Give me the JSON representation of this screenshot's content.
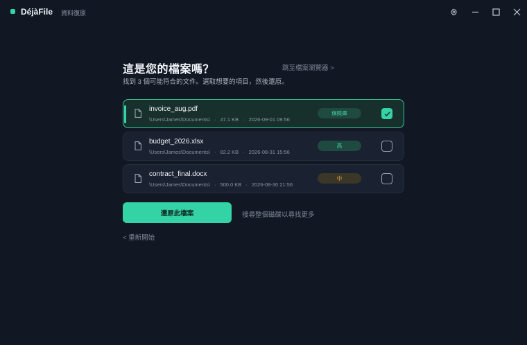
{
  "app": {
    "name": "DéjàFile",
    "section": "資料復原"
  },
  "header": {
    "title": "這是您的檔案嗎？",
    "subtitle": "找到 3 個可能符合的文件。選取想要的項目，然後還原。",
    "browse_link": "跳至檔案瀏覽器 >"
  },
  "files": [
    {
      "name": "invoice_aug.pdf",
      "path": "\\Users\\James\\Documents\\",
      "size": "47.1 KB",
      "date": "2026-09-01 09:56",
      "badge": "保險庫",
      "badge_color": "#49d6a9",
      "selected": true
    },
    {
      "name": "budget_2026.xlsx",
      "path": "\\Users\\James\\Documents\\",
      "size": "82.2 KB",
      "date": "2026-08-31 15:56",
      "badge": "高",
      "badge_color": "#49d6a9",
      "selected": false
    },
    {
      "name": "contract_final.docx",
      "path": "\\Users\\James\\Documents\\",
      "size": "500.0 KB",
      "date": "2026-08-30 21:56",
      "badge": "中",
      "badge_color": "#e9a84a",
      "selected": false
    }
  ],
  "meta_separator": "·",
  "actions": {
    "restore_button": "還原此檔案",
    "deep_scan_link": "搜尋整個磁碟以尋找更多",
    "restart_link": "< 重新開始"
  },
  "colors": {
    "accent": "#34d3a6",
    "background": "#111823",
    "card": "#1a2130",
    "warning": "#e9a84a"
  },
  "icons": {
    "settings": "gear-icon",
    "minimize": "minimize-icon",
    "maximize": "maximize-icon",
    "close": "close-icon",
    "file": "file-icon",
    "check": "check-icon"
  }
}
